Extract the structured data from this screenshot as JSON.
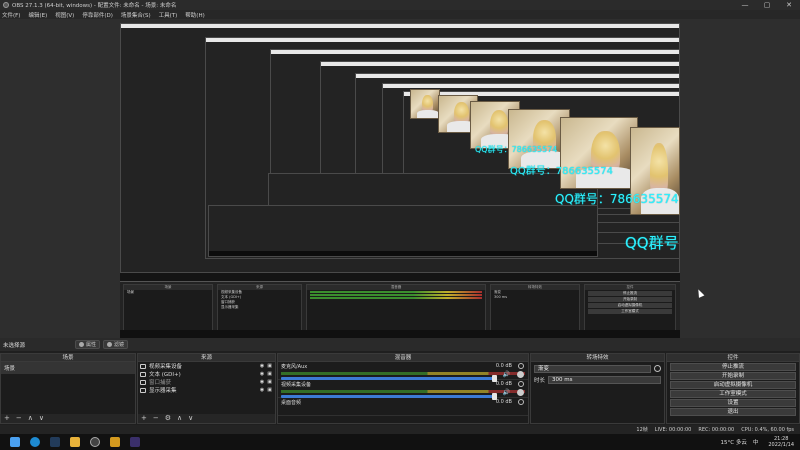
{
  "window": {
    "title": "OBS 27.1.3 (64-bit, windows) - 配置文件: 未命名 - 场景: 未命名",
    "controls": [
      "—",
      "▢",
      "✕"
    ]
  },
  "menu": [
    "文件(F)",
    "编辑(E)",
    "视图(V)",
    "停靠部件(D)",
    "场景集合(S)",
    "工具(T)",
    "帮助(H)"
  ],
  "preview": {
    "overlay_text": "QQ群号：786635574",
    "inner_window_title": "OBS 27.1.3 (64-bit, windows) - 配置文件: 未命名 - 场景: 未命名"
  },
  "scene_bar": {
    "label": "未选择源",
    "properties_button": "属性",
    "filters_button": "滤镜"
  },
  "scenes": {
    "title": "场景",
    "items": [
      "场景"
    ],
    "footer": [
      "+",
      "−",
      "∧",
      "∨"
    ]
  },
  "sources": {
    "title": "来源",
    "items": [
      {
        "label": "视频采集设备"
      },
      {
        "label": "文本 (GDI+)"
      },
      {
        "label": "窗口捕获"
      },
      {
        "label": "显示器采集"
      }
    ],
    "footer": [
      "+",
      "−",
      "⚙",
      "∧",
      "∨"
    ]
  },
  "mixer": {
    "title": "混音器",
    "tracks": [
      {
        "name": "麦克风/Aux",
        "db": "0.0 dB"
      },
      {
        "name": "视频采集设备",
        "db": "0.0 dB"
      },
      {
        "name": "桌面音频",
        "db": "0.0 dB"
      }
    ]
  },
  "transitions": {
    "title": "转场特效",
    "type": "渐变",
    "duration_label": "时长",
    "duration_value": "300 ms"
  },
  "controls": {
    "title": "控件",
    "buttons": [
      "停止推流",
      "开始录制",
      "启动虚拟摄像机",
      "工作室模式",
      "设置",
      "退出"
    ]
  },
  "status": {
    "drop": "12帧",
    "live": "LIVE: 00:00:00",
    "rec": "REC: 00:00:00",
    "cpu": "CPU: 0.4%, 60.00 fps"
  },
  "taskbar": {
    "weather": "15°C  多云",
    "ime": "中",
    "time": "21:28",
    "date": "2022/1/14"
  },
  "colors": {
    "accent_cyan": "#2ff0ff",
    "slider_blue": "#3c7bd6",
    "meter_green": "#3b8a2c"
  }
}
